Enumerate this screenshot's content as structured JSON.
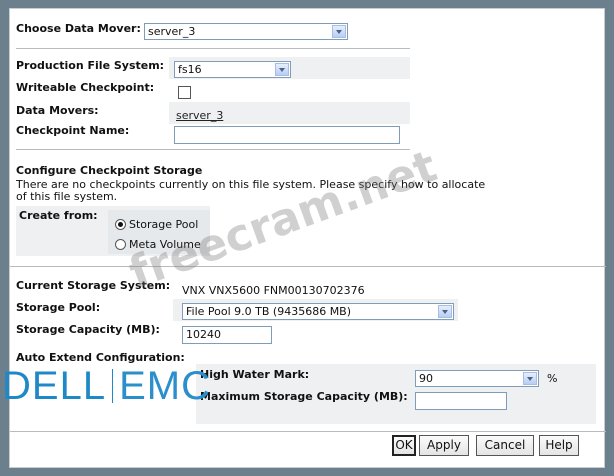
{
  "data_mover_row": {
    "label": "Choose Data Mover:",
    "value": "server_3"
  },
  "checkpoint": {
    "pfs_label": "Production File System:",
    "pfs_value": "fs16",
    "writeable_label": "Writeable Checkpoint:",
    "writeable_checked": false,
    "movers_label": "Data Movers:",
    "movers_value": "server_3",
    "name_label": "Checkpoint Name:",
    "name_value": ""
  },
  "storage_config": {
    "heading": "Configure Checkpoint Storage",
    "note_line1": "There are no checkpoints currently on this file system. Please specify how to allocate",
    "note_line2": "of this file system.",
    "create_from_label": "Create from:",
    "options": [
      {
        "label": "Storage Pool",
        "selected": true
      },
      {
        "label": "Meta Volume",
        "selected": false
      }
    ]
  },
  "storage": {
    "system_label": "Current Storage System:",
    "system_value": "VNX VNX5600 FNM00130702376",
    "pool_label": "Storage Pool:",
    "pool_value": "File Pool 9.0 TB (9435686 MB)",
    "capacity_label": "Storage Capacity (MB):",
    "capacity_value": "10240"
  },
  "auto_extend": {
    "label": "Auto Extend Configuration:",
    "hwm_label": "High Water Mark:",
    "hwm_value": "90",
    "hwm_unit": "%",
    "max_label": "Maximum Storage Capacity (MB):",
    "max_value": ""
  },
  "buttons": {
    "ok": "OK",
    "apply": "Apply",
    "cancel": "Cancel",
    "help": "Help"
  },
  "overlays": {
    "watermark": "freecram.net",
    "logo_dell": "DELL",
    "logo_emc": "EMC"
  },
  "colors": {
    "background": "#6c7f8c",
    "panel": "#ffffff",
    "logo": "#1f88c7"
  }
}
